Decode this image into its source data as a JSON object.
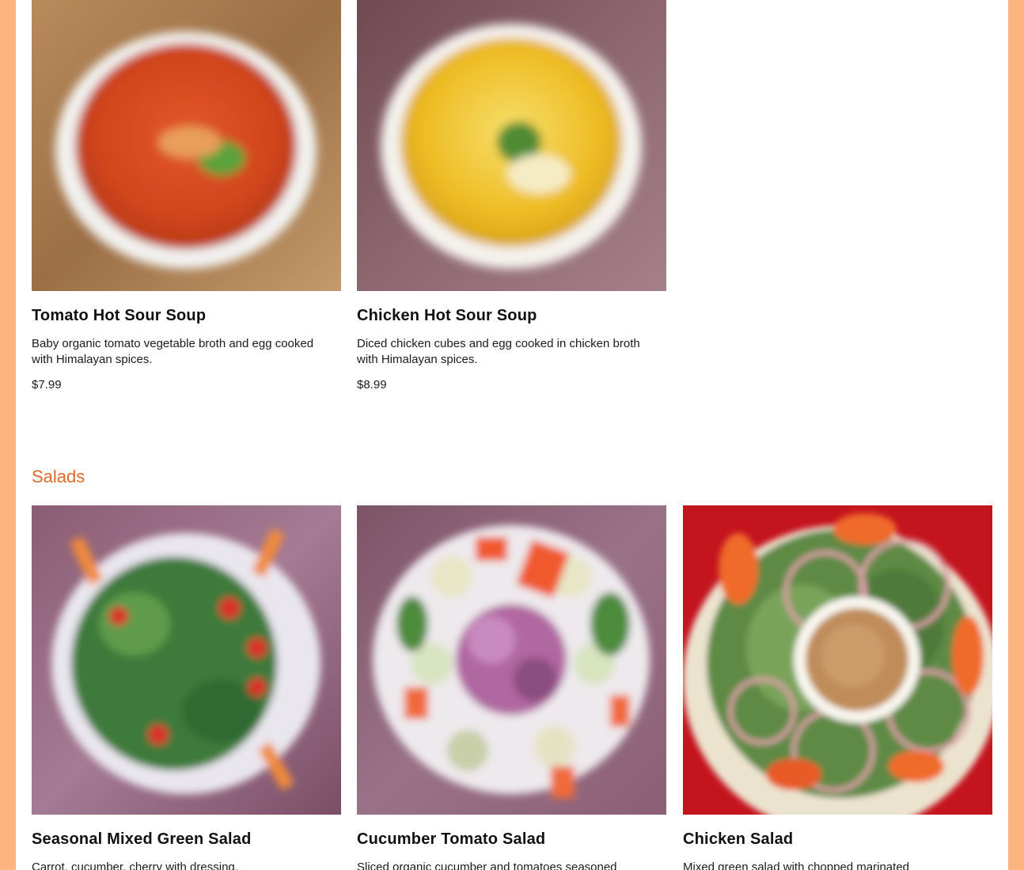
{
  "soups": {
    "items": [
      {
        "name": "Tomato Hot Sour Soup",
        "description": "Baby organic tomato vegetable broth and egg cooked with Himalayan spices.",
        "price": "$7.99"
      },
      {
        "name": "Chicken Hot Sour Soup",
        "description": "Diced chicken cubes and egg cooked in chicken broth with Himalayan spices.",
        "price": "$8.99"
      }
    ]
  },
  "salads": {
    "title": "Salads",
    "items": [
      {
        "name": "Seasonal Mixed Green Salad",
        "description": "Carrot, cucumber, cherry with dressing."
      },
      {
        "name": "Cucumber Tomato Salad",
        "description": "Sliced organic cucumber and tomatoes seasoned"
      },
      {
        "name": "Chicken Salad",
        "description": "Mixed green salad with chopped marinated"
      }
    ]
  },
  "colors": {
    "page_border": "#fdb47f",
    "section_title": "#e0682a"
  }
}
